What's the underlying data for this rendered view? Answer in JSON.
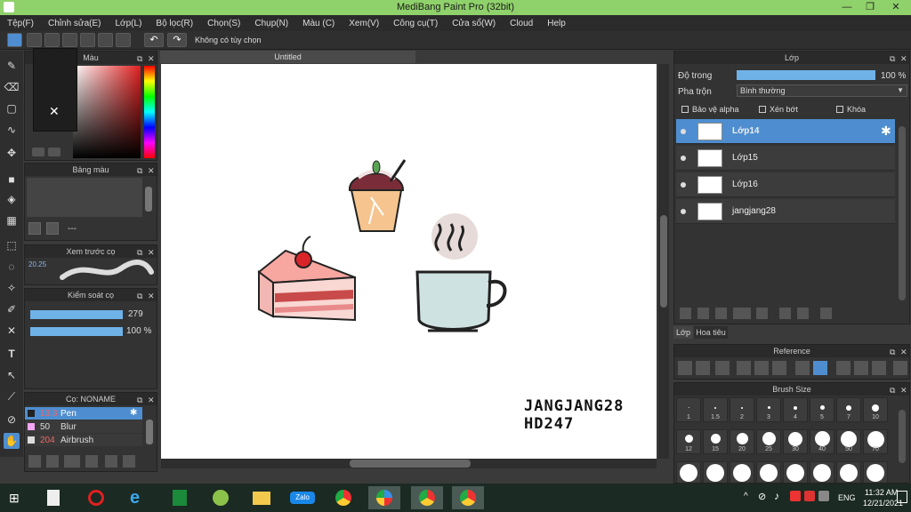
{
  "window": {
    "title": "MediBang Paint Pro (32bit)",
    "minimize": "—",
    "restore": "❐",
    "close": "✕"
  },
  "menu": [
    "Tệp(F)",
    "Chỉnh sửa(E)",
    "Lớp(L)",
    "Bộ lọc(R)",
    "Chọn(S)",
    "Chụp(N)",
    "Màu (C)",
    "Xem(V)",
    "Công cụ(T)",
    "Cửa sổ(W)",
    "Cloud",
    "Help"
  ],
  "toolbar": {
    "antialias_label": "Không có tùy chọn"
  },
  "color_panel": {
    "title": "Màu"
  },
  "palette_panel": {
    "title": "Bảng màu",
    "footer": "---"
  },
  "brush_preview": {
    "title": "Xem trước cọ",
    "size": "20.25"
  },
  "brush_control": {
    "title": "Kiểm soát cọ",
    "size_value": "279",
    "opacity_value": "100 %"
  },
  "brush_list": {
    "title": "Cọ: NONAME",
    "items": [
      {
        "size": "13.3",
        "name": "Pen",
        "selected": true
      },
      {
        "size": "50",
        "name": "Blur",
        "selected": false
      },
      {
        "size": "204",
        "name": "Airbrush",
        "selected": false
      }
    ]
  },
  "document": {
    "tab": "Untitled",
    "signature_line1": "JANGJANG28",
    "signature_line2": "HD247"
  },
  "layer_panel": {
    "title": "Lớp",
    "opacity_label": "Độ trong",
    "opacity_value": "100 %",
    "blend_label": "Pha trộn",
    "blend_value": "Bình thường",
    "checks": [
      "Bảo vệ alpha",
      "Xén bớt",
      "Khóa"
    ],
    "layers": [
      {
        "name": "Lớp14",
        "selected": true
      },
      {
        "name": "Lớp15",
        "selected": false
      },
      {
        "name": "Lớp16",
        "selected": false
      },
      {
        "name": "jangjang28",
        "selected": false
      }
    ],
    "tabs": [
      "Lớp",
      "Hoa tiêu"
    ]
  },
  "reference_panel": {
    "title": "Reference"
  },
  "brush_size_panel": {
    "title": "Brush Size",
    "sizes": [
      "1",
      "1.5",
      "2",
      "3",
      "4",
      "5",
      "7",
      "10",
      "12",
      "15",
      "20",
      "25",
      "30",
      "40",
      "50",
      "70"
    ]
  },
  "taskbar": {
    "lang": "ENG",
    "time": "11:32 AM",
    "date": "12/21/2021",
    "zalo": "Zalo"
  }
}
